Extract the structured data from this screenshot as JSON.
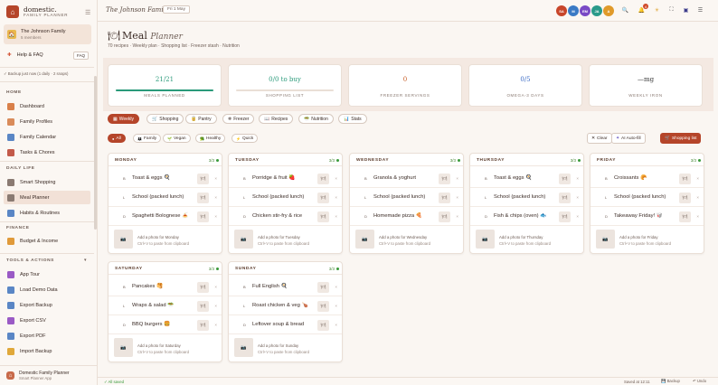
{
  "sidebar": {
    "brand_name": "domestic.",
    "brand_sub": "FAMILY PLANNER",
    "family_name": "The Johnson Family",
    "family_members": "5 members",
    "help_label": "Help & FAQ",
    "faq_badge": "FAQ",
    "backup_status": "✓ Backup just now (1 daily · 2 snaps)",
    "sections": {
      "home": "HOME",
      "daily": "DAILY LIFE",
      "finance": "FINANCE",
      "tools": "TOOLS & ACTIONS"
    },
    "home_items": [
      {
        "label": "Dashboard",
        "icon": "grid-icon",
        "color": "#d9804a"
      },
      {
        "label": "Family Profiles",
        "icon": "people-icon",
        "color": "#d98b5a"
      },
      {
        "label": "Family Calendar",
        "icon": "calendar-icon",
        "color": "#5a86c5"
      },
      {
        "label": "Tasks & Chores",
        "icon": "check-icon",
        "color": "#c35a4a"
      }
    ],
    "daily_items": [
      {
        "label": "Smart Shopping",
        "icon": "cart-icon",
        "color": "#8a7a72"
      },
      {
        "label": "Meal Planner",
        "icon": "menu-icon",
        "color": "#8a7a72"
      },
      {
        "label": "Habits & Routines",
        "icon": "habit-icon",
        "color": "#5a86c5"
      }
    ],
    "finance_items": [
      {
        "label": "Budget & Income",
        "icon": "money-icon",
        "color": "#e09a3a"
      }
    ],
    "tools_items": [
      {
        "label": "App Tour",
        "icon": "tour-icon",
        "color": "#9a5ac5"
      },
      {
        "label": "Load Demo Data",
        "icon": "database-icon",
        "color": "#5a86c5"
      },
      {
        "label": "Export Backup",
        "icon": "export-icon",
        "color": "#5a86c5"
      },
      {
        "label": "Export CSV",
        "icon": "csv-icon",
        "color": "#9a5ac5"
      },
      {
        "label": "Export PDF",
        "icon": "pdf-icon",
        "color": "#5a86c5"
      },
      {
        "label": "Import Backup",
        "icon": "import-icon",
        "color": "#e0a83a"
      }
    ],
    "footer_title": "Domestic Family Planner",
    "footer_sub": "Smart Planner App"
  },
  "topbar": {
    "title": "The Johnson Family",
    "date": "Fri 1 May",
    "avatars": [
      {
        "initials": "SA",
        "color": "#c8452a"
      },
      {
        "initials": "M",
        "color": "#3a7ac5"
      },
      {
        "initials": "EM",
        "color": "#7a4ac5"
      },
      {
        "initials": "JA",
        "color": "#2a9a8a"
      },
      {
        "initials": "A",
        "color": "#e09a2a"
      }
    ],
    "notif_count": "4"
  },
  "page": {
    "title": "Meal",
    "title_italic": "Planner",
    "subtitle": "70 recipes · Weekly plan · Shopping list · Freezer stash · Nutrition"
  },
  "stats": [
    {
      "value": "21/21",
      "label": "MEALS PLANNED",
      "progress": 1.0,
      "color": "#2a9a7a"
    },
    {
      "value": "0/0 to buy",
      "label": "SHOPPING LIST",
      "progress": 0.0,
      "color": "#2a9a7a"
    },
    {
      "value": "0",
      "label": "FREEZER SERVINGS",
      "progress": null,
      "color": "#c8602a"
    },
    {
      "value": "0/5",
      "label": "OMEGA-3 DAYS",
      "progress": null,
      "color": "#3a6ac5"
    },
    {
      "value": "—mg",
      "label": "WEEKLY IRON",
      "progress": null,
      "color": "#3a3a3a"
    }
  ],
  "tabs": [
    {
      "label": "Weekly",
      "icon": "calendar-icon",
      "active": true
    },
    {
      "label": "Shopping",
      "icon": "cart-icon",
      "active": false
    },
    {
      "label": "Pantry",
      "icon": "pantry-icon",
      "active": false
    },
    {
      "label": "Freezer",
      "icon": "snowflake-icon",
      "active": false
    },
    {
      "label": "Recipes",
      "icon": "book-icon",
      "active": false
    },
    {
      "label": "Nutrition",
      "icon": "nutrition-icon",
      "active": false
    },
    {
      "label": "Stats",
      "icon": "chart-icon",
      "active": false
    }
  ],
  "filters": [
    {
      "label": "All",
      "active": true
    },
    {
      "label": "Family",
      "active": false
    },
    {
      "label": "Vegan",
      "active": false
    },
    {
      "label": "Healthy",
      "active": false
    },
    {
      "label": "Quick",
      "active": false
    }
  ],
  "actions": {
    "clear": "Clear",
    "autofill": "AI Auto-fill",
    "shopping": "Shopping list"
  },
  "meal_labels": {
    "b": "B",
    "l": "L",
    "d": "D"
  },
  "meal_btn": "🍽",
  "photo": {
    "line1_prefix": "Add a photo for",
    "line2": "Ctrl+V to paste from clipboard"
  },
  "days": [
    {
      "day": "MONDAY",
      "count": "3/3",
      "b": "Toast & eggs 🍳",
      "l": "School (packed lunch)",
      "d": "Spaghetti Bolognese 🍝",
      "photo": "Add a photo for Monday"
    },
    {
      "day": "TUESDAY",
      "count": "3/3",
      "b": "Porridge & fruit 🍓",
      "l": "School (packed lunch)",
      "d": "Chicken stir-fry & rice",
      "photo": "Add a photo for Tuesday"
    },
    {
      "day": "WEDNESDAY",
      "count": "3/3",
      "b": "Granola & yoghurt",
      "l": "School (packed lunch)",
      "d": "Homemade pizza 🍕",
      "photo": "Add a photo for Wednesday"
    },
    {
      "day": "THURSDAY",
      "count": "3/3",
      "b": "Toast & eggs 🍳",
      "l": "School (packed lunch)",
      "d": "Fish & chips (oven) 🐟",
      "photo": "Add a photo for Thursday"
    },
    {
      "day": "FRIDAY",
      "count": "3/3",
      "b": "Croissants 🥐",
      "l": "School (packed lunch)",
      "d": "Takeaway Friday! 🥡",
      "photo": "Add a photo for Friday"
    },
    {
      "day": "SATURDAY",
      "count": "3/3",
      "b": "Pancakes 🥞",
      "l": "Wraps & salad 🥗",
      "d": "BBQ burgers 🍔",
      "photo": "Add a photo for Saturday"
    },
    {
      "day": "SUNDAY",
      "count": "3/3",
      "b": "Full English 🍳",
      "l": "Roast chicken & veg 🍗",
      "d": "Leftover soup & bread",
      "photo": "Add a photo for Sunday"
    }
  ],
  "footer": {
    "saved": "✓ All saved",
    "saved_at": "Saved at 12:11",
    "backup": "Backup",
    "undo": "Undo"
  }
}
